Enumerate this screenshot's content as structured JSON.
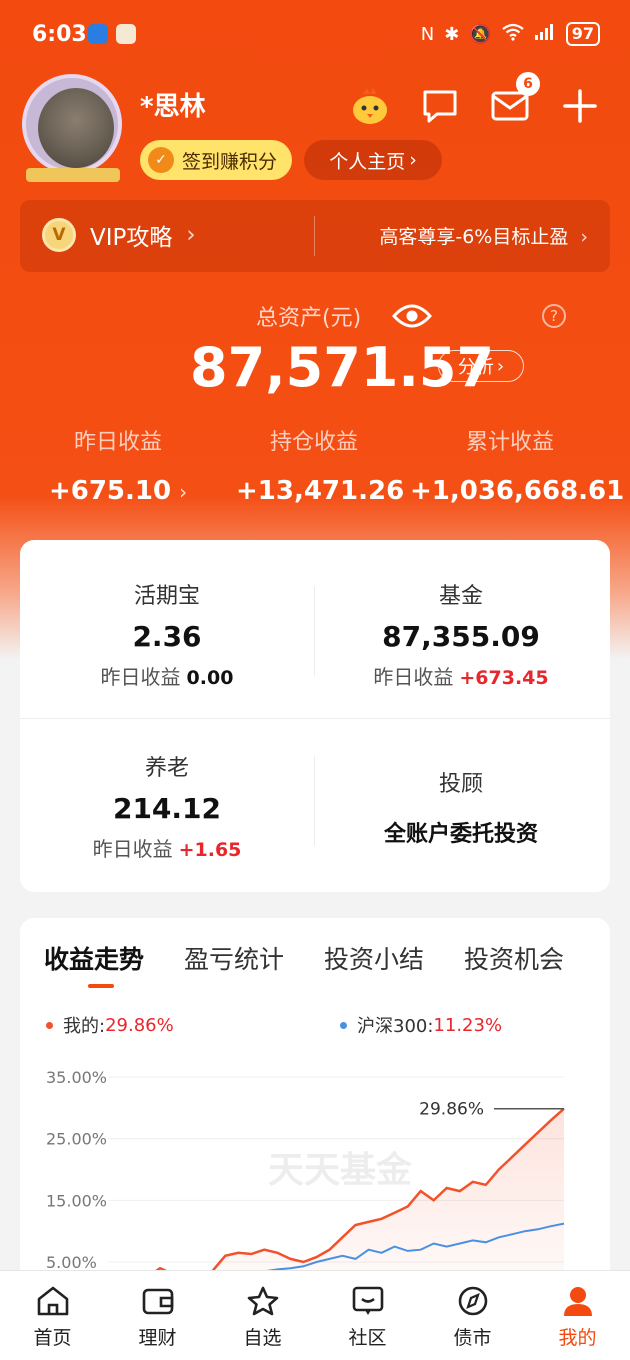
{
  "status_bar": {
    "time": "6:03",
    "battery": "97"
  },
  "profile": {
    "username": "*思林",
    "checkin_label": "签到赚积分",
    "homepage_label": "个人主页",
    "mail_badge": "6"
  },
  "vip": {
    "left_label": "VIP攻略",
    "right_label": "高客尊享-6%目标止盈"
  },
  "assets": {
    "label": "总资产(元)",
    "total": "87,571.57",
    "analysis_label": "分析",
    "earnings": [
      {
        "label": "昨日收益",
        "value": "+675.10"
      },
      {
        "label": "持仓收益",
        "value": "+13,471.26"
      },
      {
        "label": "累计收益",
        "value": "+1,036,668.61"
      }
    ]
  },
  "accounts": {
    "huoqibao": {
      "title": "活期宝",
      "value": "2.36",
      "sub_label": "昨日收益",
      "sub_value": "0.00"
    },
    "fund": {
      "title": "基金",
      "value": "87,355.09",
      "sub_label": "昨日收益",
      "sub_value": "+673.45"
    },
    "pension": {
      "title": "养老",
      "value": "214.12",
      "sub_label": "昨日收益",
      "sub_value": "+1.65"
    },
    "advisor": {
      "title": "投顾",
      "desc": "全账户委托投资"
    }
  },
  "chart_section": {
    "tabs": [
      "收益走势",
      "盈亏统计",
      "投资小结",
      "投资机会"
    ],
    "legend_mine_label": "我的:",
    "legend_mine_value": "29.86%",
    "legend_index_label": "沪深300:",
    "legend_index_value": "11.23%",
    "end_label": "29.86%",
    "watermark": "天天基金",
    "colors": {
      "mine": "#f2522a",
      "index": "#4a90e2"
    }
  },
  "chart_data": {
    "type": "line",
    "yticks": [
      "35.00%",
      "25.00%",
      "15.00%",
      "5.00%"
    ],
    "ylim": [
      0,
      35
    ],
    "series": [
      {
        "name": "我的",
        "final": 29.86,
        "values": [
          2.0,
          1.5,
          3.0,
          2.5,
          4.0,
          3.0,
          2.0,
          2.5,
          3.5,
          6.0,
          6.5,
          6.3,
          7.0,
          6.5,
          5.5,
          5.0,
          5.8,
          7.0,
          9.0,
          11.0,
          11.5,
          12.0,
          13.0,
          14.0,
          16.5,
          15.0,
          17.0,
          16.5,
          18.0,
          17.5,
          20.0,
          22.0,
          24.0,
          26.0,
          28.0,
          29.86
        ]
      },
      {
        "name": "沪深300",
        "final": 11.23,
        "values": [
          0.5,
          0.8,
          1.0,
          1.2,
          1.5,
          1.3,
          1.0,
          1.2,
          1.6,
          2.0,
          2.5,
          3.0,
          3.5,
          3.8,
          4.0,
          4.3,
          5.0,
          5.5,
          6.0,
          5.5,
          7.0,
          6.5,
          7.5,
          6.8,
          7.0,
          8.0,
          7.5,
          8.0,
          8.5,
          8.2,
          9.0,
          9.5,
          10.0,
          10.3,
          10.8,
          11.23
        ]
      }
    ]
  },
  "nav": {
    "items": [
      {
        "label": "首页",
        "icon": "home-icon"
      },
      {
        "label": "理财",
        "icon": "wallet-icon"
      },
      {
        "label": "自选",
        "icon": "star-icon"
      },
      {
        "label": "社区",
        "icon": "community-icon"
      },
      {
        "label": "债市",
        "icon": "compass-icon"
      },
      {
        "label": "我的",
        "icon": "user-icon"
      }
    ]
  }
}
